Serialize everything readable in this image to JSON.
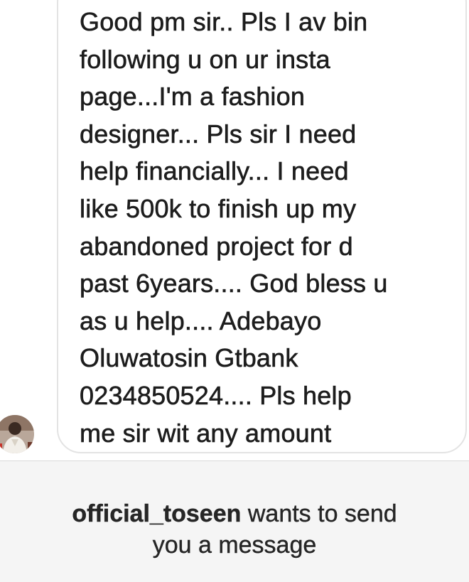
{
  "message": {
    "lines": [
      "Good pm sir.. Pls I av bin",
      "following u on ur insta",
      "page...I'm a fashion",
      "designer... Pls sir I need",
      "help financially... I need",
      "like  500k to finish up my",
      "abandoned project for d",
      "past 6years.... God bless u",
      "as u help.... Adebayo",
      "Oluwatosin Gtbank",
      "0234850524.... Pls help",
      "me sir wit any amount"
    ]
  },
  "request": {
    "username": "official_toseen",
    "text_line1": " wants to send",
    "text_line2": "you a message"
  },
  "colors": {
    "bubble_border": "#e3e3e3",
    "footer_bg": "#f5f5f5",
    "text": "#1d1d1d"
  }
}
